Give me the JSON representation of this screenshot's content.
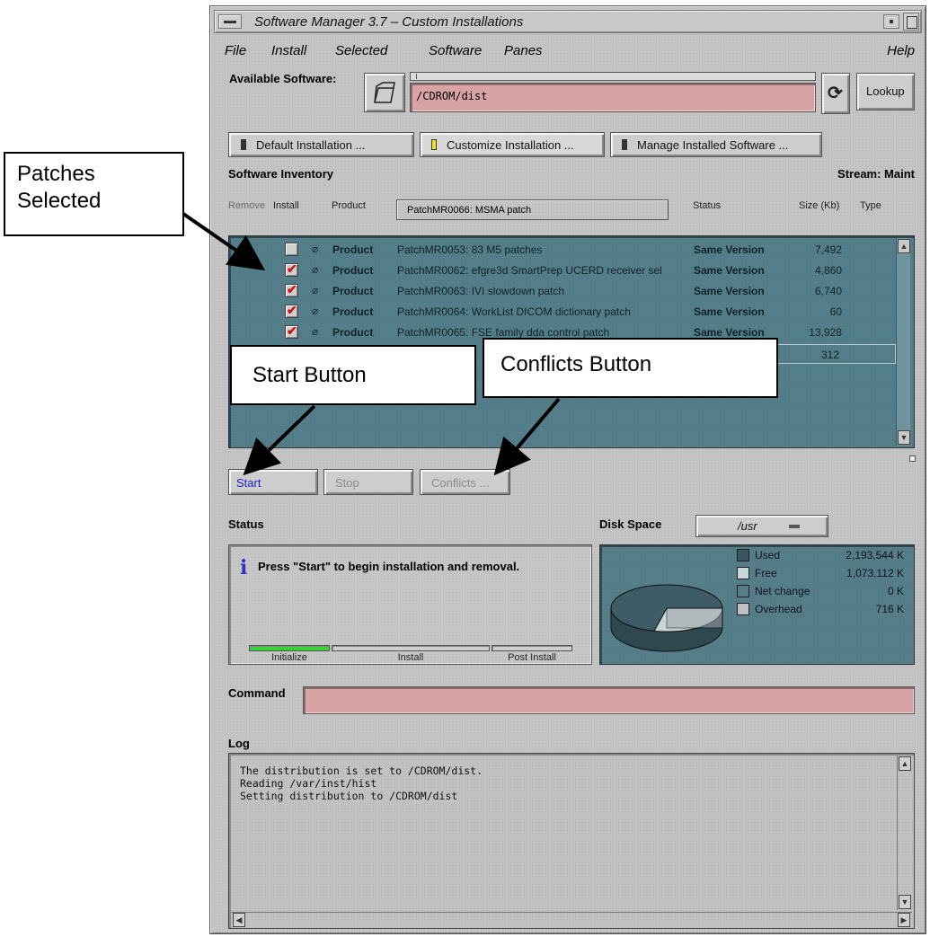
{
  "window": {
    "title": "Software Manager 3.7 – Custom Installations"
  },
  "menubar": {
    "items": [
      "File",
      "Install",
      "Selected",
      "Software",
      "Panes"
    ],
    "help": "Help"
  },
  "available": {
    "label": "Available Software:",
    "path": "/CDROM/dist",
    "lookup_label": "Lookup"
  },
  "modes": {
    "default": "Default Installation ...",
    "customize": "Customize Installation ...",
    "manage": "Manage Installed Software ..."
  },
  "inventory": {
    "title": "Software Inventory",
    "stream": "Stream: Maint",
    "columns": {
      "remove": "Remove",
      "install": "Install",
      "product": "Product",
      "status": "Status",
      "size": "Size (Kb)",
      "type": "Type"
    },
    "selected_product": "PatchMR0066: MSMA patch",
    "rows": [
      {
        "checked": false,
        "type": "Product",
        "name": "PatchMR0053: 83 M5 patches",
        "status": "Same Version",
        "size": "7,492"
      },
      {
        "checked": true,
        "type": "Product",
        "name": "PatchMR0062: efgre3d SmartPrep UCERD receiver sel",
        "status": "Same Version",
        "size": "4,860"
      },
      {
        "checked": true,
        "type": "Product",
        "name": "PatchMR0063: IVI slowdown patch",
        "status": "Same Version",
        "size": "6,740"
      },
      {
        "checked": true,
        "type": "Product",
        "name": "PatchMR0064: WorkList DICOM dictionary patch",
        "status": "Same Version",
        "size": "60"
      },
      {
        "checked": true,
        "type": "Product",
        "name": "PatchMR0065: FSE family dda control patch",
        "status": "Same Version",
        "size": "13,928"
      }
    ],
    "extra_size": "312"
  },
  "actions": {
    "start": "Start",
    "stop": "Stop",
    "conflicts": "Conflicts ..."
  },
  "status": {
    "title": "Status",
    "message": "Press \"Start\" to begin installation and removal.",
    "stages": [
      "Initialize",
      "Install",
      "Post Install"
    ],
    "initialize_progress": 1.0
  },
  "disk": {
    "title": "Disk Space",
    "volume": "/usr",
    "legend": [
      {
        "label": "Used",
        "value": "2,193,544 K",
        "color": "#3a5560"
      },
      {
        "label": "Free",
        "value": "1,073,112 K",
        "color": "#c9d6da"
      },
      {
        "label": "Net change",
        "value": "0 K",
        "color": "#557e89"
      },
      {
        "label": "Overhead",
        "value": "716 K",
        "color": "#c0c0c0"
      }
    ]
  },
  "command": {
    "label": "Command",
    "value": ""
  },
  "log": {
    "title": "Log",
    "lines": [
      "The distribution is set to /CDROM/dist.",
      "Reading /var/inst/hist",
      "Setting distribution to /CDROM/dist"
    ]
  },
  "annotations": {
    "patches": "Patches Selected",
    "start": "Start Button",
    "conflicts": "Conflicts Button"
  }
}
